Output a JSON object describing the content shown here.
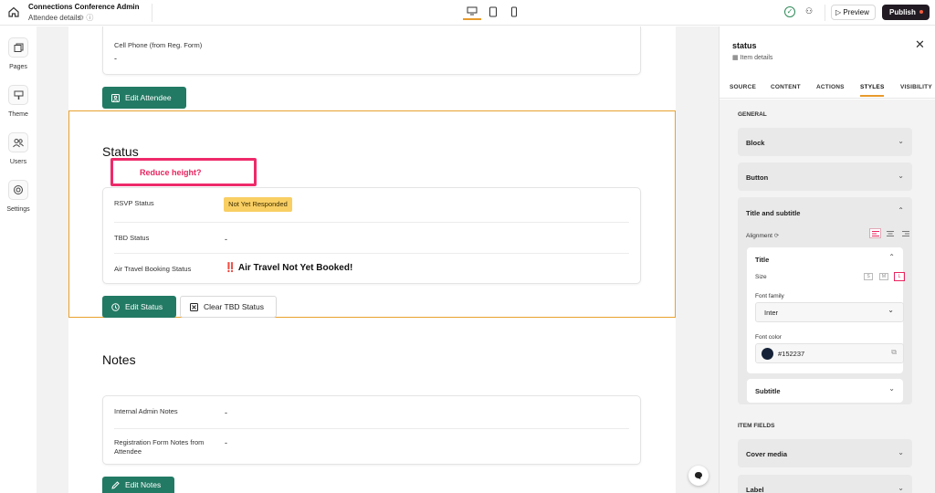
{
  "topbar": {
    "app_title": "Connections Conference Admin",
    "app_subtitle": "Attendee details",
    "preview_label": "Preview",
    "publish_label": "Publish"
  },
  "leftnav": [
    {
      "label": "Pages",
      "icon": "pages-icon"
    },
    {
      "label": "Theme",
      "icon": "theme-icon"
    },
    {
      "label": "Users",
      "icon": "users-icon"
    },
    {
      "label": "Settings",
      "icon": "settings-icon"
    }
  ],
  "canvas": {
    "cell_phone_label": "Cell Phone (from Reg. Form)",
    "cell_phone_value": "-",
    "edit_attendee_label": "Edit Attendee",
    "status_title": "Status",
    "annotation": "Reduce height?",
    "status_rows": [
      {
        "label": "RSVP Status",
        "value": "Not Yet Responded"
      },
      {
        "label": "TBD Status",
        "value": "-"
      },
      {
        "label": "Air Travel Booking Status",
        "value": "Air Travel Not Yet Booked!"
      }
    ],
    "air_travel_prefix": "‼️",
    "edit_status_label": "Edit Status",
    "clear_tbd_label": "Clear TBD Status",
    "notes_title": "Notes",
    "notes_rows": [
      {
        "label": "Internal Admin Notes",
        "value": "-"
      },
      {
        "label": "Registration Form Notes from Attendee",
        "value": "-"
      }
    ],
    "edit_notes_label": "Edit Notes"
  },
  "panel": {
    "title": "status",
    "subtitle": "Item details",
    "tabs": [
      "SOURCE",
      "CONTENT",
      "ACTIONS",
      "STYLES",
      "VISIBILITY"
    ],
    "active_tab": "STYLES",
    "general_label": "GENERAL",
    "block_label": "Block",
    "button_label": "Button",
    "title_subtitle_label": "Title and subtitle",
    "alignment_label": "Alignment",
    "title_label": "Title",
    "size_label": "Size",
    "size_options": [
      "S",
      "M",
      "L"
    ],
    "selected_size": "L",
    "font_family_label": "Font family",
    "font_family_value": "Inter",
    "font_color_label": "Font color",
    "font_color_value": "#152237",
    "subtitle_label": "Subtitle",
    "item_fields_label": "ITEM FIELDS",
    "cover_media_label": "Cover media",
    "label_label": "Label"
  },
  "colors": {
    "accent": "#237a64",
    "selection": "#e8a12d",
    "annotation": "#ee2a6a",
    "badge": "#f9cf64",
    "font_color_swatch": "#152237"
  }
}
